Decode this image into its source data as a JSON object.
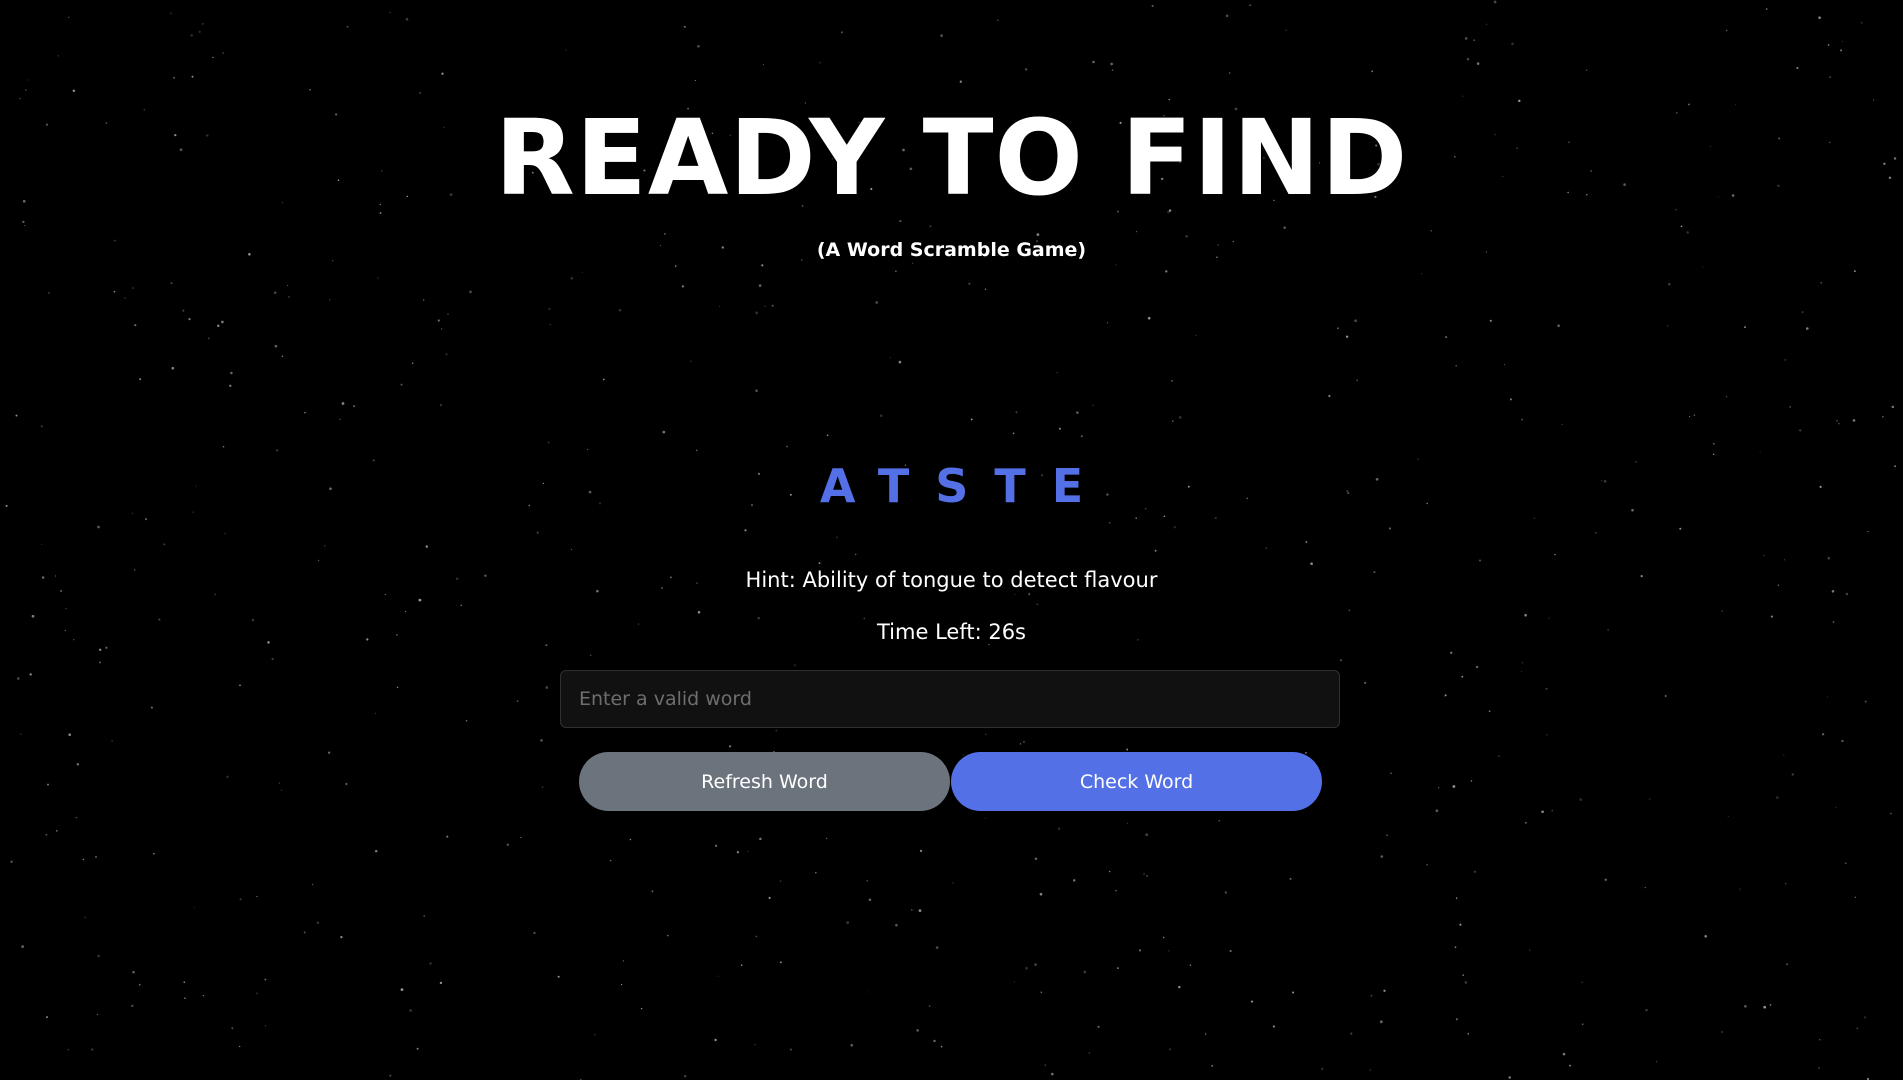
{
  "game": {
    "title": "READY TO FIND",
    "subtitle": "(A Word Scramble Game)",
    "scrambled_word": "ATSTE",
    "hint": "Hint: Ability of tongue to detect flavour",
    "timer": "Time Left: 26s"
  },
  "input": {
    "placeholder": "Enter a valid word",
    "value": ""
  },
  "buttons": {
    "refresh_label": "Refresh Word",
    "check_label": "Check Word"
  },
  "colors": {
    "background": "#000000",
    "accent": "#5470e6",
    "secondary_button": "#6b737c",
    "text": "#ffffff"
  }
}
